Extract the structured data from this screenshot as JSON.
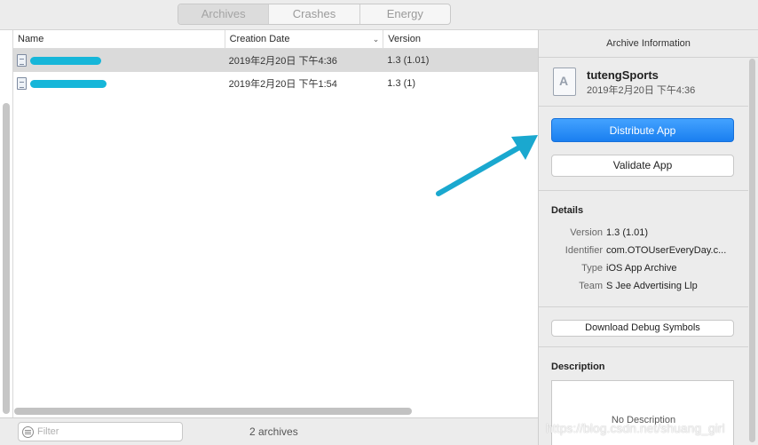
{
  "tabs": [
    {
      "label": "Archives",
      "active": true
    },
    {
      "label": "Crashes",
      "active": false
    },
    {
      "label": "Energy",
      "active": false
    }
  ],
  "table": {
    "columns": [
      "Name",
      "Creation Date",
      "Version"
    ],
    "rows": [
      {
        "date": "2019年2月20日 下午4:36",
        "version": "1.3 (1.01)",
        "selected": true
      },
      {
        "date": "2019年2月20日 下午1:54",
        "version": "1.3 (1)",
        "selected": false
      }
    ]
  },
  "filter": {
    "placeholder": "Filter",
    "value": ""
  },
  "status": {
    "count": "2 archives"
  },
  "inspector": {
    "header": "Archive Information",
    "app_name": "tutengSports",
    "app_date": "2019年2月20日 下午4:36",
    "distribute_label": "Distribute App",
    "validate_label": "Validate App",
    "details_title": "Details",
    "details": [
      {
        "label": "Version",
        "value": "1.3 (1.01)"
      },
      {
        "label": "Identifier",
        "value": "com.OTOUserEveryDay.c..."
      },
      {
        "label": "Type",
        "value": "iOS App Archive"
      },
      {
        "label": "Team",
        "value": "S Jee Advertising Llp"
      }
    ],
    "debug_label": "Download Debug Symbols",
    "description_title": "Description",
    "description_text": "No Description"
  },
  "watermark": "https://blog.csdn.net/shuang_girl",
  "colors": {
    "accent": "#1a7ff0",
    "redaction": "#16b6d9",
    "arrow": "#1aa8cf"
  }
}
